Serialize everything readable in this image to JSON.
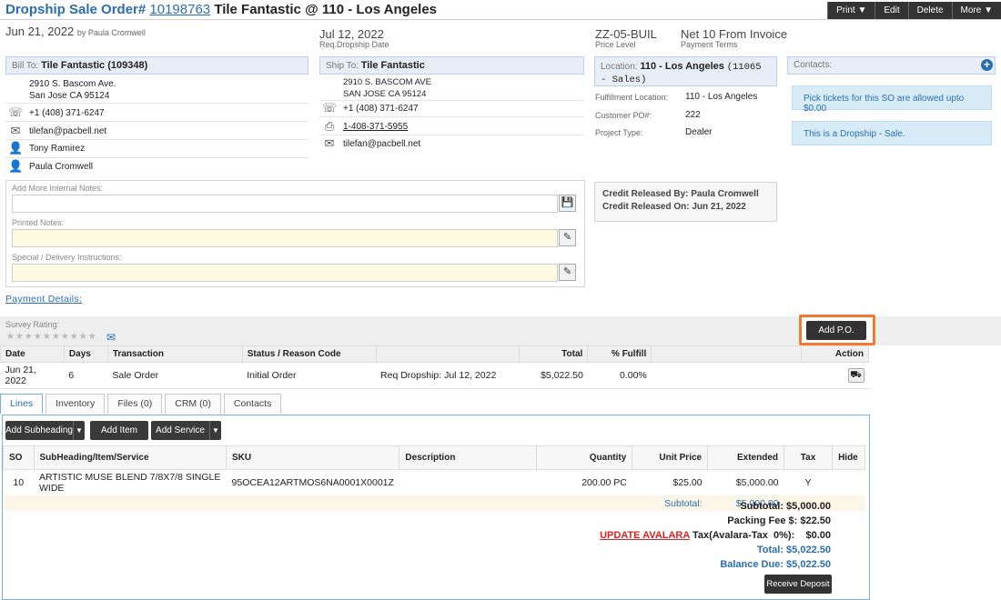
{
  "header": {
    "prefix": "Dropship Sale Order#",
    "order_number": "10198763",
    "customer": "Tile Fantastic @ 110 - Los Angeles",
    "buttons": [
      "Print ▼",
      "Edit",
      "Delete",
      "More ▼"
    ]
  },
  "meta": {
    "order_date": "Jun 21, 2022",
    "created_by": "by Paula Cromwell",
    "req_date": "Jul 12, 2022",
    "req_date_label": "Req.Dropship Date",
    "price_level": "ZZ-05-BUIL",
    "price_level_label": "Price Level",
    "payment_terms": "Net 10 From Invoice",
    "payment_terms_label": "Payment Terms"
  },
  "bill_to": {
    "label": "Bill To:",
    "name": "Tile Fantastic (109348)",
    "address1": "2910 S. Bascom Ave.",
    "address2": "San Jose CA 95124",
    "phone": "+1 (408) 371-6247",
    "email": "tilefan@pacbell.net",
    "contact": "Tony Ramirez",
    "salesperson": "Paula Cromwell"
  },
  "ship_to": {
    "label": "Ship To:",
    "name": "Tile Fantastic",
    "address1": "2910 S. BASCOM AVE",
    "address2": "SAN JOSE CA 95124",
    "phone": "+1 (408) 371-6247",
    "fax": "1-408-371-5955",
    "email": "tilefan@pacbell.net"
  },
  "location": {
    "label": "Location:",
    "name": "110 - Los Angeles",
    "code": "(11065 - Sales)",
    "fulfillment_label": "Fulfillment Location:",
    "fulfillment": "110 - Los Angeles",
    "po_label": "Customer PO#:",
    "po": "222",
    "project_label": "Project Type:",
    "project": "Dealer"
  },
  "contacts": {
    "label": "Contacts:",
    "pick_info": "Pick tickets for this SO are allowed upto  $0.00",
    "dropship_info": "This is a Dropship - Sale."
  },
  "notes": {
    "internal_label": "Add More Internal Notes:",
    "printed_label": "Printed Notes:",
    "special_label": "Special / Delivery Instructions:"
  },
  "credit": {
    "released_by": "Credit Released By: Paula Cromwell",
    "released_on": "Credit Released On: Jun 21, 2022"
  },
  "payment_details": "Payment Details:",
  "survey": {
    "label": "Survey Rating:",
    "stars": "★★★★★★★★★★",
    "add_po": "Add P.O."
  },
  "transactions": {
    "headers": [
      "Date",
      "Days",
      "Transaction",
      "Status / Reason Code",
      "",
      "Total",
      "% Fulfill",
      "",
      "Action"
    ],
    "rows": [
      [
        "Jun 21, 2022",
        "6",
        "Sale Order",
        "Initial Order",
        "Req Dropship: Jul 12, 2022",
        "$5,022.50",
        "0.00%",
        "",
        ""
      ]
    ]
  },
  "tabs": [
    "Lines",
    "Inventory",
    "Files (0)",
    "CRM (0)",
    "Contacts"
  ],
  "line_buttons": {
    "add_subheading": "Add Subheading",
    "add_item": "Add Item",
    "add_service": "Add Service"
  },
  "lines": {
    "headers": [
      "SO",
      "SubHeading/Item/Service",
      "SKU",
      "Description",
      "Quantity",
      "Unit Price",
      "Extended",
      "Tax",
      "Hide"
    ],
    "rows": [
      [
        "10",
        "ARTISTIC MUSE BLEND 7/8X7/8 SINGLE WIDE",
        "95OCEA12ARTMOS6NA0001X0001Z",
        "",
        "200.00 PC",
        "$25.00",
        "$5,000.00",
        "Y",
        ""
      ]
    ],
    "subtotal_label": "Subtotal:",
    "subtotal_value": "$5,000.00"
  },
  "totals": {
    "subtotal": "Subtotal: $5,000.00",
    "packing": "Packing Fee $:   $22.50",
    "update_avalara": "UPDATE AVALARA",
    "tax": " Tax(Avalara-Tax  0%):    $0.00",
    "total": "Total: $5,022.50",
    "balance": "Balance Due: $5,022.50",
    "receive_deposit": "Receive Deposit"
  }
}
